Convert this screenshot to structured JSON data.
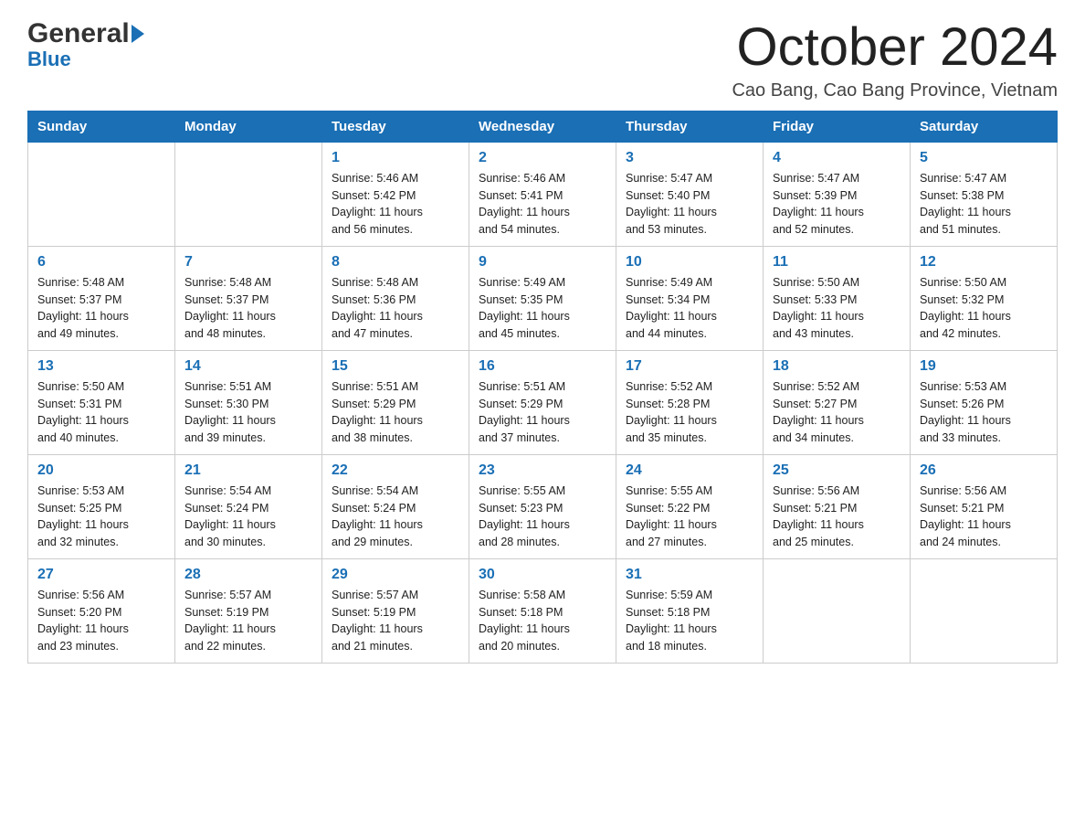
{
  "header": {
    "logo_general": "General",
    "logo_blue": "Blue",
    "month_title": "October 2024",
    "location": "Cao Bang, Cao Bang Province, Vietnam"
  },
  "days_of_week": [
    "Sunday",
    "Monday",
    "Tuesday",
    "Wednesday",
    "Thursday",
    "Friday",
    "Saturday"
  ],
  "weeks": [
    [
      {
        "day": "",
        "info": ""
      },
      {
        "day": "",
        "info": ""
      },
      {
        "day": "1",
        "info": "Sunrise: 5:46 AM\nSunset: 5:42 PM\nDaylight: 11 hours\nand 56 minutes."
      },
      {
        "day": "2",
        "info": "Sunrise: 5:46 AM\nSunset: 5:41 PM\nDaylight: 11 hours\nand 54 minutes."
      },
      {
        "day": "3",
        "info": "Sunrise: 5:47 AM\nSunset: 5:40 PM\nDaylight: 11 hours\nand 53 minutes."
      },
      {
        "day": "4",
        "info": "Sunrise: 5:47 AM\nSunset: 5:39 PM\nDaylight: 11 hours\nand 52 minutes."
      },
      {
        "day": "5",
        "info": "Sunrise: 5:47 AM\nSunset: 5:38 PM\nDaylight: 11 hours\nand 51 minutes."
      }
    ],
    [
      {
        "day": "6",
        "info": "Sunrise: 5:48 AM\nSunset: 5:37 PM\nDaylight: 11 hours\nand 49 minutes."
      },
      {
        "day": "7",
        "info": "Sunrise: 5:48 AM\nSunset: 5:37 PM\nDaylight: 11 hours\nand 48 minutes."
      },
      {
        "day": "8",
        "info": "Sunrise: 5:48 AM\nSunset: 5:36 PM\nDaylight: 11 hours\nand 47 minutes."
      },
      {
        "day": "9",
        "info": "Sunrise: 5:49 AM\nSunset: 5:35 PM\nDaylight: 11 hours\nand 45 minutes."
      },
      {
        "day": "10",
        "info": "Sunrise: 5:49 AM\nSunset: 5:34 PM\nDaylight: 11 hours\nand 44 minutes."
      },
      {
        "day": "11",
        "info": "Sunrise: 5:50 AM\nSunset: 5:33 PM\nDaylight: 11 hours\nand 43 minutes."
      },
      {
        "day": "12",
        "info": "Sunrise: 5:50 AM\nSunset: 5:32 PM\nDaylight: 11 hours\nand 42 minutes."
      }
    ],
    [
      {
        "day": "13",
        "info": "Sunrise: 5:50 AM\nSunset: 5:31 PM\nDaylight: 11 hours\nand 40 minutes."
      },
      {
        "day": "14",
        "info": "Sunrise: 5:51 AM\nSunset: 5:30 PM\nDaylight: 11 hours\nand 39 minutes."
      },
      {
        "day": "15",
        "info": "Sunrise: 5:51 AM\nSunset: 5:29 PM\nDaylight: 11 hours\nand 38 minutes."
      },
      {
        "day": "16",
        "info": "Sunrise: 5:51 AM\nSunset: 5:29 PM\nDaylight: 11 hours\nand 37 minutes."
      },
      {
        "day": "17",
        "info": "Sunrise: 5:52 AM\nSunset: 5:28 PM\nDaylight: 11 hours\nand 35 minutes."
      },
      {
        "day": "18",
        "info": "Sunrise: 5:52 AM\nSunset: 5:27 PM\nDaylight: 11 hours\nand 34 minutes."
      },
      {
        "day": "19",
        "info": "Sunrise: 5:53 AM\nSunset: 5:26 PM\nDaylight: 11 hours\nand 33 minutes."
      }
    ],
    [
      {
        "day": "20",
        "info": "Sunrise: 5:53 AM\nSunset: 5:25 PM\nDaylight: 11 hours\nand 32 minutes."
      },
      {
        "day": "21",
        "info": "Sunrise: 5:54 AM\nSunset: 5:24 PM\nDaylight: 11 hours\nand 30 minutes."
      },
      {
        "day": "22",
        "info": "Sunrise: 5:54 AM\nSunset: 5:24 PM\nDaylight: 11 hours\nand 29 minutes."
      },
      {
        "day": "23",
        "info": "Sunrise: 5:55 AM\nSunset: 5:23 PM\nDaylight: 11 hours\nand 28 minutes."
      },
      {
        "day": "24",
        "info": "Sunrise: 5:55 AM\nSunset: 5:22 PM\nDaylight: 11 hours\nand 27 minutes."
      },
      {
        "day": "25",
        "info": "Sunrise: 5:56 AM\nSunset: 5:21 PM\nDaylight: 11 hours\nand 25 minutes."
      },
      {
        "day": "26",
        "info": "Sunrise: 5:56 AM\nSunset: 5:21 PM\nDaylight: 11 hours\nand 24 minutes."
      }
    ],
    [
      {
        "day": "27",
        "info": "Sunrise: 5:56 AM\nSunset: 5:20 PM\nDaylight: 11 hours\nand 23 minutes."
      },
      {
        "day": "28",
        "info": "Sunrise: 5:57 AM\nSunset: 5:19 PM\nDaylight: 11 hours\nand 22 minutes."
      },
      {
        "day": "29",
        "info": "Sunrise: 5:57 AM\nSunset: 5:19 PM\nDaylight: 11 hours\nand 21 minutes."
      },
      {
        "day": "30",
        "info": "Sunrise: 5:58 AM\nSunset: 5:18 PM\nDaylight: 11 hours\nand 20 minutes."
      },
      {
        "day": "31",
        "info": "Sunrise: 5:59 AM\nSunset: 5:18 PM\nDaylight: 11 hours\nand 18 minutes."
      },
      {
        "day": "",
        "info": ""
      },
      {
        "day": "",
        "info": ""
      }
    ]
  ]
}
